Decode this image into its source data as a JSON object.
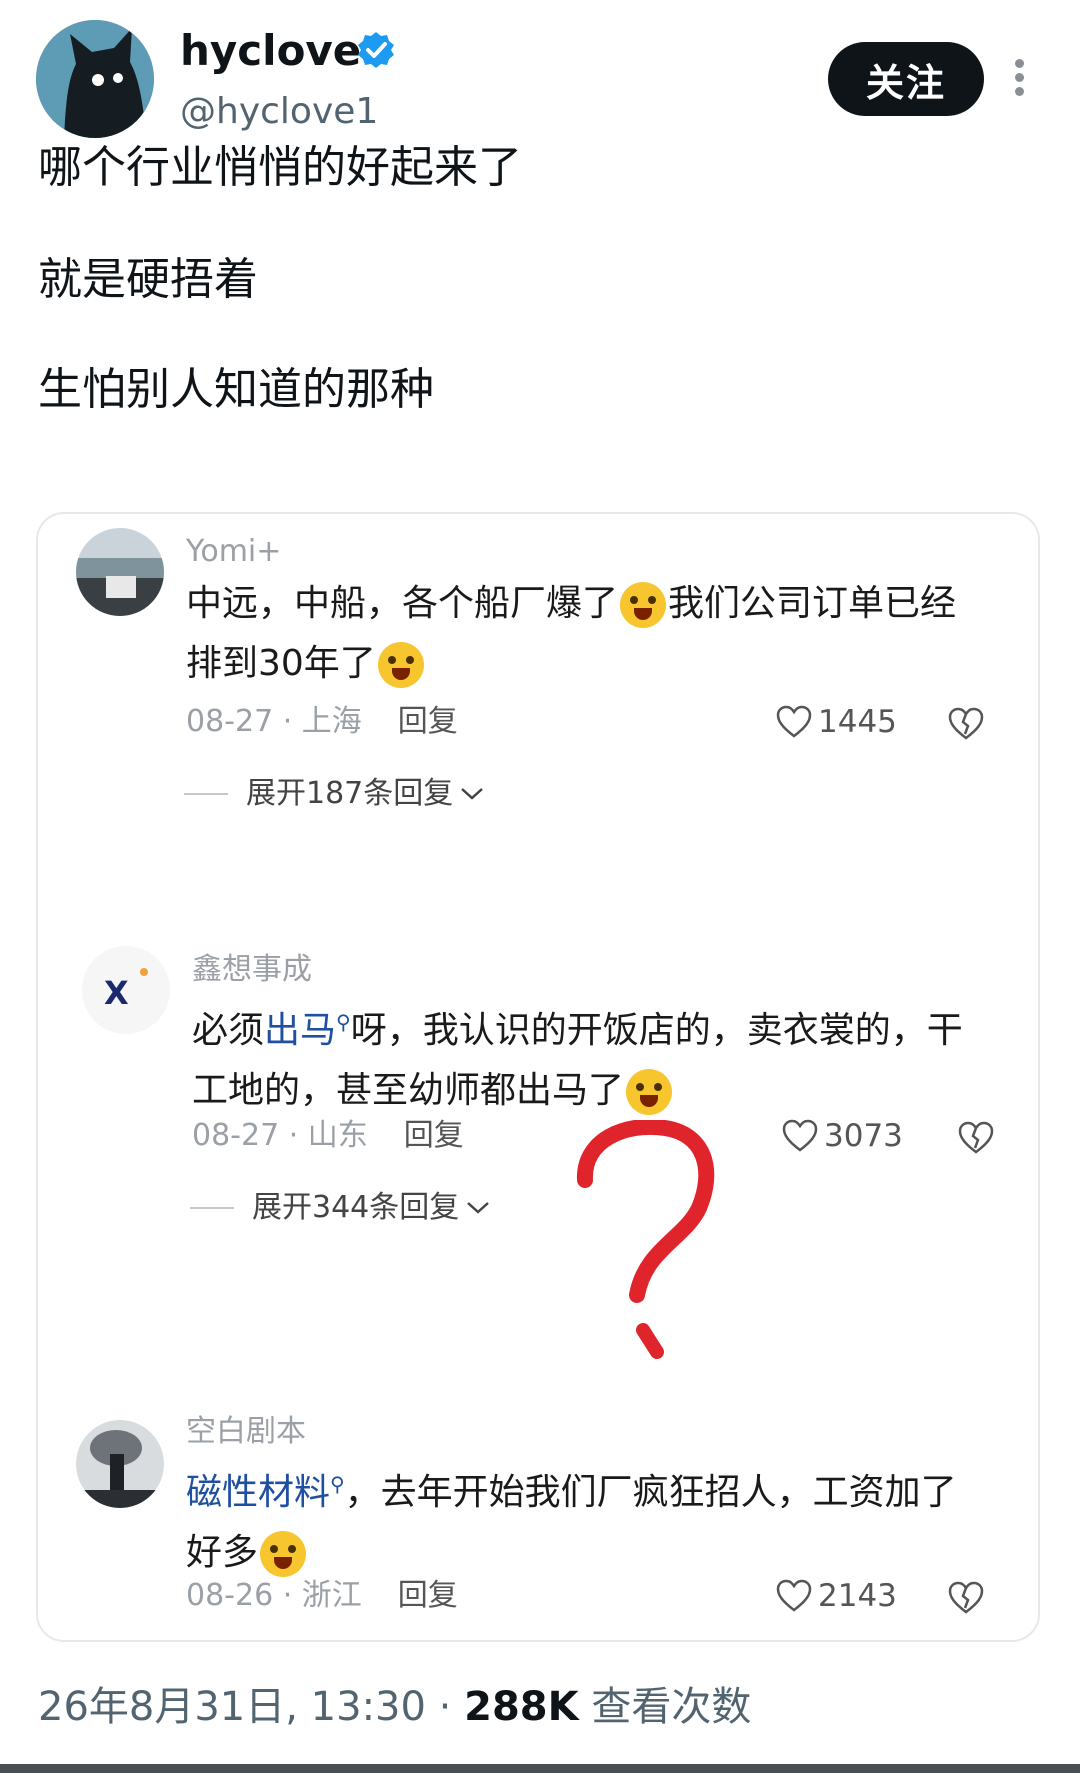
{
  "author": {
    "display_name": "hyclove",
    "handle": "@hyclove1",
    "follow_label": "关注"
  },
  "post": {
    "lines": [
      "哪个行业悄悄的好起来了",
      "就是硬捂着",
      "生怕别人知道的那种"
    ]
  },
  "comments": [
    {
      "name": "Yomi+",
      "text_a": "中远，中船，各个船厂爆了",
      "text_b": "我们公司订单已经",
      "text_c": "排到30年了",
      "date": "08-27",
      "location": "上海",
      "reply_label": "回复",
      "likes": "1445",
      "expand_label": "展开187条回复"
    },
    {
      "name": "鑫想事成",
      "text_a": "必须",
      "keyword": "出马",
      "text_b": "呀，我认识的开饭店的，卖衣裳的，干",
      "text_c": "工地的，甚至幼师都出马了",
      "date": "08-27",
      "location": "山东",
      "reply_label": "回复",
      "likes": "3073",
      "expand_label": "展开344条回复"
    },
    {
      "name": "空白剧本",
      "keyword": "磁性材料",
      "text_b": "，去年开始我们厂疯狂招人，工资加了",
      "text_c": "好多",
      "date": "08-26",
      "location": "浙江",
      "reply_label": "回复",
      "likes": "2143"
    }
  ],
  "footer": {
    "timestamp": "26年8月31日, 13:30",
    "separator": "·",
    "views": "288K",
    "views_label": "查看次数"
  },
  "colors": {
    "verified": "#1d9bf0",
    "keyword_link": "#1f4fa0",
    "annotation_red": "#e0242c"
  }
}
